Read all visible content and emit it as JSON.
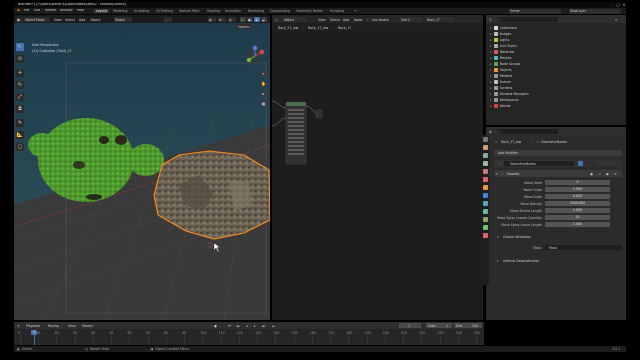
{
  "window": {
    "title": "Blender* [C:\\Users\\BuildFX\\Downloads\\Defo2 - Moodify.blend]",
    "controls": [
      "–",
      "▢",
      "✕"
    ]
  },
  "menubar": {
    "menus": [
      "File",
      "Edit",
      "Render",
      "Window",
      "Help"
    ],
    "workspaces": [
      "Layout",
      "Modeling",
      "Sculpting",
      "UV Editing",
      "Texture Paint",
      "Shading",
      "Animation",
      "Rendering",
      "Compositing",
      "Geometry Nodes",
      "Scripting"
    ],
    "active_workspace": "Layout",
    "scene": "Scene",
    "view_layer": "ViewLayer"
  },
  "viewport": {
    "mode": "Object Mode",
    "menus": [
      "View",
      "Select",
      "Add",
      "Object"
    ],
    "transform": "Global",
    "overlay_title": "User Perspective",
    "overlay_collection": "(11) Collection | Rock_17",
    "options": "Options"
  },
  "node_editor": {
    "editor": "Object",
    "menus": [
      "View",
      "Select",
      "Add",
      "Node"
    ],
    "use_nodes_label": "Use Nodes",
    "slot": "Slot 1",
    "material": "Rock_17",
    "breadcrumb": [
      "Rock_17_low",
      "Rock_17_low",
      "Rock_17"
    ]
  },
  "outliner": {
    "search_placeholder": "",
    "items": [
      "Collections",
      "Images",
      "Lights",
      "Line Styles",
      "Materials",
      "Meshes",
      "Node Groups",
      "Objects",
      "Palettes",
      "Scenes",
      "Screens",
      "Window Managers",
      "Workspaces",
      "Worlds"
    ]
  },
  "properties": {
    "object_path": [
      "Rock_17_low",
      "GeometryNodes"
    ],
    "add_modifier": "Add Modifier",
    "node_group": "GeometryNodes",
    "modifier_name": "Moodify",
    "fields": [
      {
        "label": "Noise Seed",
        "value": "0"
      },
      {
        "label": "Noise Scale",
        "value": "1.000"
      },
      {
        "label": "Mesa Scale",
        "value": "0.020"
      },
      {
        "label": "Mesa Density",
        "value": "1500.000"
      },
      {
        "label": "Mesa Strand Length",
        "value": "1.000"
      },
      {
        "label": "Mesa Splay Leaves Quantity",
        "value": "20"
      },
      {
        "label": "Mesa Splay Leave Length",
        "value": "1.000"
      }
    ],
    "output_attributes": "Output Attributes",
    "moss_label": "Moss",
    "moss_value": "Moss",
    "internal_dependencies": "Internal Dependencies"
  },
  "timeline": {
    "menus": [
      "Playback",
      "Keying",
      "View",
      "Marker"
    ],
    "current_frame": "1",
    "start_label": "Start",
    "start": "1",
    "end_label": "End",
    "end": "250",
    "ticks": [
      "0",
      "10",
      "20",
      "30",
      "40",
      "50",
      "60",
      "70",
      "80",
      "90",
      "100",
      "110",
      "120",
      "130",
      "140",
      "150",
      "160",
      "170",
      "180",
      "190",
      "200",
      "210",
      "220",
      "230",
      "240",
      "250"
    ]
  },
  "statusbar": {
    "select": "Select",
    "rotate": "Rotate View",
    "context": "Object Context Menu",
    "version": "3.0.1"
  },
  "colors": {
    "accent": "#4772b3",
    "selected_outline": "#ff8c1a",
    "monkey": "#4e9a2e"
  }
}
